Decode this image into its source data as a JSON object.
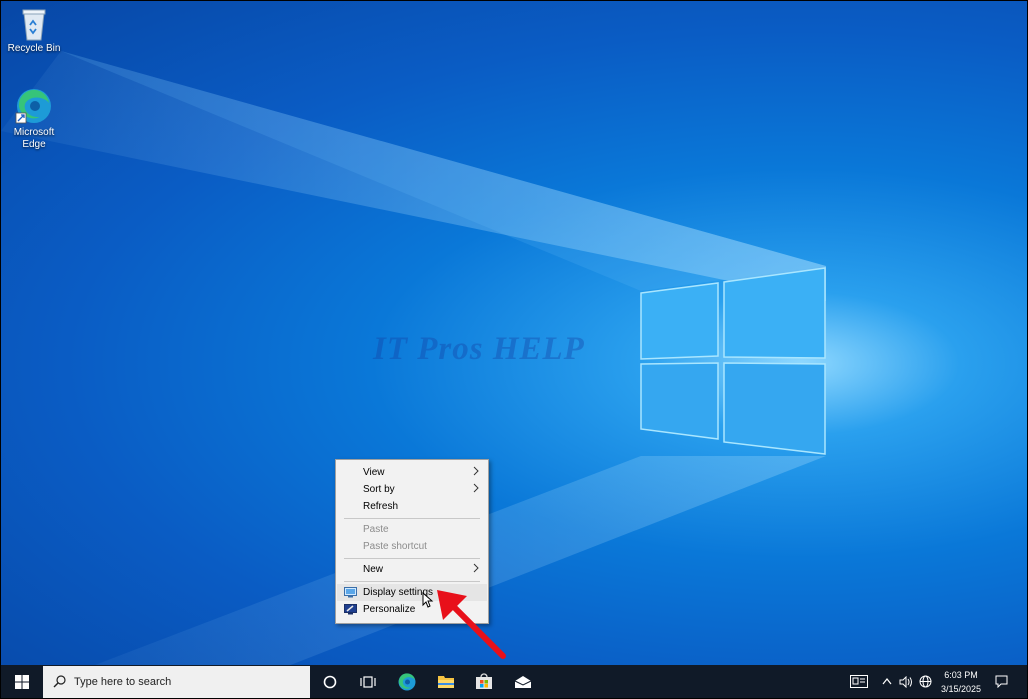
{
  "desktop": {
    "icons": [
      {
        "label": "Recycle Bin",
        "icon": "recycle-bin-icon"
      },
      {
        "label": "Microsoft Edge",
        "icon": "edge-icon"
      }
    ],
    "watermark": "IT Pros HELP"
  },
  "context_menu": {
    "items": [
      {
        "label": "View",
        "submenu": true,
        "enabled": true
      },
      {
        "label": "Sort by",
        "submenu": true,
        "enabled": true
      },
      {
        "label": "Refresh",
        "enabled": true
      },
      {
        "label": "Paste",
        "enabled": false
      },
      {
        "label": "Paste shortcut",
        "enabled": false
      },
      {
        "label": "New",
        "submenu": true,
        "enabled": true
      },
      {
        "label": "Display settings",
        "icon": "display-icon",
        "enabled": true,
        "highlighted": true
      },
      {
        "label": "Personalize",
        "icon": "personalize-icon",
        "enabled": true
      }
    ]
  },
  "taskbar": {
    "search_placeholder": "Type here to search",
    "apps": [
      "cortana-icon",
      "task-view-icon",
      "edge-icon",
      "file-explorer-icon",
      "store-icon",
      "mail-icon"
    ],
    "clock": {
      "time": "6:03 PM",
      "date": "3/15/2025"
    }
  },
  "colors": {
    "desktop_blue": "#0a6fd2",
    "taskbar": "#101a28",
    "menu_bg": "#f2f2f2",
    "annotation_red": "#e8101a"
  }
}
